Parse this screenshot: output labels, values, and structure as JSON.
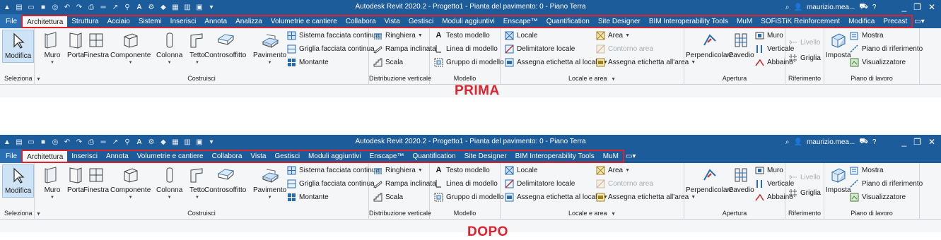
{
  "screenshots": [
    {
      "key": "before",
      "caption": "PRIMA",
      "title": "Autodesk Revit 2020.2 - Progetto1 - Pianta del pavimento: 0 - Piano Terra",
      "user": "maurizio.mea...",
      "tabs": [
        "Architettura",
        "Struttura",
        "Acciaio",
        "Sistemi",
        "Inserisci",
        "Annota",
        "Analizza",
        "Volumetrie e cantiere",
        "Collabora",
        "Vista",
        "Gestisci",
        "Moduli aggiuntivi",
        "Enscape™",
        "Quantification",
        "Site Designer",
        "BIM Interoperability Tools",
        "MuM",
        "SOFiSTiK Reinforcement",
        "Modifica",
        "Precast"
      ]
    },
    {
      "key": "after",
      "caption": "DOPO",
      "title": "Autodesk Revit 2020.2 - Progetto1 - Pianta del pavimento: 0 - Piano Terra",
      "user": "maurizio.mea...",
      "tabs": [
        "Architettura",
        "Inserisci",
        "Annota",
        "Volumetrie e cantiere",
        "Collabora",
        "Vista",
        "Gestisci",
        "Moduli aggiuntivi",
        "Enscape™",
        "Quantification",
        "Site Designer",
        "BIM Interoperability Tools",
        "MuM"
      ]
    }
  ],
  "file_tab": "File",
  "ribbon": {
    "seleziona": {
      "modifica": "Modifica",
      "title": "Seleziona"
    },
    "costruisci": {
      "title": "Costruisci",
      "muro": "Muro",
      "porta": "Porta",
      "finestra": "Finestra",
      "componente": "Componente",
      "colonna": "Colonna",
      "tetto": "Tetto",
      "controsoffitto": "Controsoffitto",
      "pavimento": "Pavimento",
      "sistema_facciata": "Sistema facciata continua",
      "griglia_facciata": "Griglia facciata continua",
      "montante": "Montante"
    },
    "distribuzione": {
      "title": "Distribuzione verticale",
      "ringhiera": "Ringhiera",
      "rampa": "Rampa inclinata",
      "scala": "Scala"
    },
    "modello": {
      "title": "Modello",
      "testo": "Testo modello",
      "linea": "Linea di modello",
      "gruppo": "Gruppo di modello"
    },
    "locale": {
      "title": "Locale e area",
      "locale": "Locale",
      "delimitatore": "Delimitatore locale",
      "assegna_locale": "Assegna etichetta  al locale",
      "area": "Area",
      "contorno": "Contorno area",
      "assegna_area": "Assegna etichetta  all'area"
    },
    "apertura": {
      "title": "Apertura",
      "perpendicolare": "Perpendicolare",
      "cavedio": "Cavedio",
      "muro": "Muro",
      "verticale": "Verticale",
      "abbaino": "Abbaino"
    },
    "riferimento": {
      "title": "Riferimento",
      "livello": "Livello",
      "griglia": "Griglia"
    },
    "piano": {
      "title": "Piano di lavoro",
      "imposta": "Imposta",
      "mostra": "Mostra",
      "piano_rif": "Piano di riferimento",
      "visualizzatore": "Visualizzatore"
    }
  },
  "colors": {
    "titlebar": "#1d5c9a",
    "highlight": "#e0202a",
    "ribbon_bg": "#f5f6f7"
  }
}
